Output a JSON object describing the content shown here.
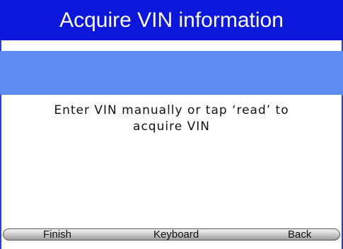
{
  "header": {
    "title": "Acquire VIN information"
  },
  "vin_input": {
    "value": ""
  },
  "message": {
    "line1": "Enter VIN manually or tap ‘read’ to",
    "line2": "acquire VIN"
  },
  "footer": {
    "finish_label": "Finish",
    "keyboard_label": "Keyboard",
    "back_label": "Back"
  },
  "colors": {
    "title_bar": "#0b17dd",
    "input_band": "#5b8cf0",
    "frame_border": "#2a3fd9"
  }
}
